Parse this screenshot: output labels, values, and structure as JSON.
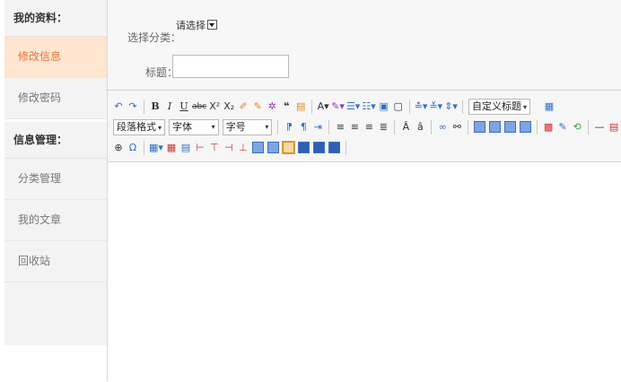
{
  "sidebar": {
    "section1": "我的资料：",
    "items1": [
      "修改信息",
      "修改密码"
    ],
    "section2": "信息管理：",
    "items2": [
      "分类管理",
      "我的文章",
      "回收站"
    ]
  },
  "form": {
    "category_label": "选择分类：",
    "category_value": "请选择",
    "title_label": "标题：",
    "title_value": ""
  },
  "toolbar": {
    "custom_heading": "自定义标题",
    "paragraph_format": "段落格式",
    "font_family": "字体",
    "font_size": "字号"
  },
  "colors": {
    "active_bg": "#fde5cf",
    "active_text": "#e8743b",
    "sidebar_bg": "#f3f3f3"
  }
}
